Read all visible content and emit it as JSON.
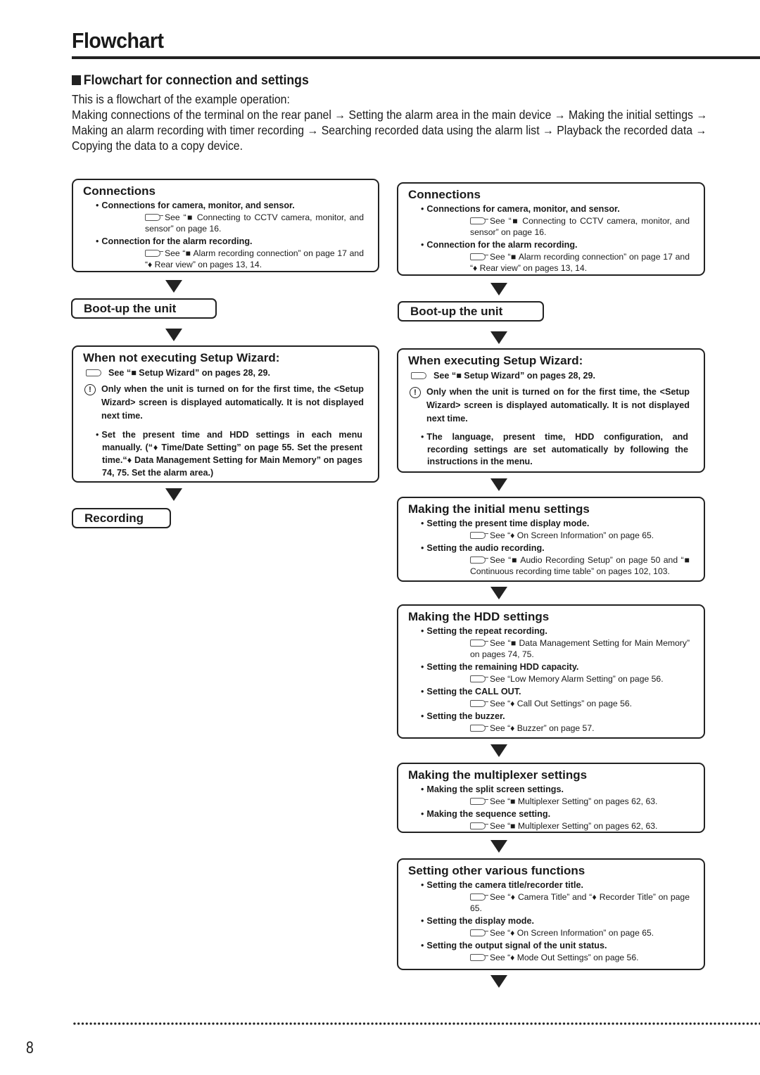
{
  "page": {
    "title": "Flowchart",
    "page_number": "8"
  },
  "section": {
    "heading": "Flowchart for connection and settings",
    "intro_line": "This is a flowchart of the example operation:",
    "intro_steps": "Making connections of the terminal on the rear panel → Setting the alarm area in the main device → Making the initial settings → Making an alarm recording with timer recording → Searching recorded data using the alarm list → Playback the recorded data → Copying the data to a copy device."
  },
  "left_column": {
    "connections": {
      "title": "Connections",
      "items": [
        {
          "label": "Connections for camera, monitor, and sensor.",
          "ref": "See “■ Connecting to CCTV camera, monitor, and sensor” on page 16."
        },
        {
          "label": "Connection for the alarm recording.",
          "ref": "See “■ Alarm recording connection” on page 17 and “♦ Rear view” on pages 13, 14."
        }
      ]
    },
    "bootup": {
      "title": "Boot-up the unit"
    },
    "wizard": {
      "title": "When not executing Setup Wizard:",
      "ref": "See “■ Setup Wizard” on pages 28, 29.",
      "note": "Only when the unit is turned on for the first time, the <Setup Wizard> screen is displayed automatically. It is not displayed next time.",
      "bullet": "Set the present time and HDD settings in each menu manually. (“♦ Time/Date Setting” on page 55. Set the present time.“♦ Data Management Setting for Main Memory” on pages 74, 75. Set the alarm area.)"
    },
    "recording": {
      "title": "Recording"
    }
  },
  "right_column": {
    "connections": {
      "title": "Connections",
      "items": [
        {
          "label": "Connections for camera, monitor, and sensor.",
          "ref": "See “■ Connecting to CCTV camera, monitor, and sensor” on page 16."
        },
        {
          "label": "Connection for the alarm recording.",
          "ref": "See “■ Alarm recording connection” on page 17 and “♦ Rear view” on pages 13, 14."
        }
      ]
    },
    "bootup": {
      "title": "Boot-up the unit"
    },
    "wizard": {
      "title": "When executing Setup Wizard:",
      "ref": "See “■ Setup Wizard” on pages 28, 29.",
      "note": "Only when the unit is turned on for the first time, the <Setup Wizard> screen is displayed automatically. It is not displayed next time.",
      "bullet": "The language, present time, HDD configuration, and recording settings are set automatically by following the instructions in the menu."
    },
    "initial_menu": {
      "title": "Making the initial menu settings",
      "items": [
        {
          "label": "Setting the present time display mode.",
          "ref": "See “♦ On Screen Information” on page 65."
        },
        {
          "label": "Setting the audio recording.",
          "ref": "See “■ Audio Recording Setup” on page 50 and “■ Continuous recording time table” on pages 102, 103."
        }
      ]
    },
    "hdd": {
      "title": "Making the HDD settings",
      "items": [
        {
          "label": "Setting the repeat recording.",
          "ref": "See “■ Data Management Setting for Main Memory” on pages 74, 75."
        },
        {
          "label": "Setting the remaining HDD capacity.",
          "ref": "See “Low Memory Alarm Setting” on page 56."
        },
        {
          "label": "Setting the CALL OUT.",
          "ref": "See “♦ Call Out Settings” on page 56."
        },
        {
          "label": "Setting the buzzer.",
          "ref": "See “♦ Buzzer” on page 57."
        }
      ]
    },
    "multiplexer": {
      "title": "Making the multiplexer settings",
      "items": [
        {
          "label": "Making the split screen settings.",
          "ref": "See “■ Multiplexer Setting” on pages 62, 63."
        },
        {
          "label": "Making the sequence setting.",
          "ref": "See “■ Multiplexer Setting” on pages 62, 63."
        }
      ]
    },
    "other": {
      "title": "Setting other various functions",
      "items": [
        {
          "label": "Setting the camera title/recorder title.",
          "ref": "See “♦ Camera Title” and “♦ Recorder Title” on page 65."
        },
        {
          "label": "Setting the display mode.",
          "ref": "See “♦ On Screen Information” on page 65."
        },
        {
          "label": "Setting the output signal of the unit status.",
          "ref": "See “♦ Mode Out Settings” on page 56."
        }
      ]
    }
  }
}
